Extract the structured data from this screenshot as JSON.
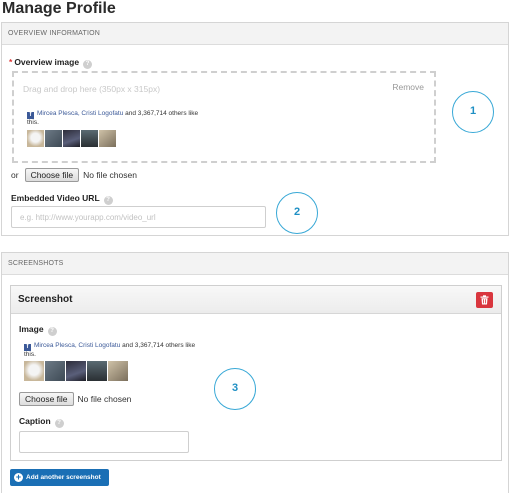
{
  "page": {
    "title": "Manage Profile"
  },
  "overview": {
    "header": "OVERVIEW INFORMATION",
    "image_label": "Overview image",
    "required_mark": "*",
    "dropzone_text": "Drag and drop here (350px x 315px)",
    "remove_label": "Remove",
    "or_label": "or",
    "choose_file_label": "Choose file",
    "no_file_label": "No file chosen",
    "video_label": "Embedded Video URL",
    "video_placeholder": "e.g. http://www.yourapp.com/video_url"
  },
  "facebook_widget": {
    "logo": "f",
    "names": "Mircea Plesca, Cristi Logofatu",
    "rest": " and 3,367,714 others like this."
  },
  "screenshots": {
    "header": "SCREENSHOTS",
    "card_title": "Screenshot",
    "image_label": "Image",
    "choose_file_label": "Choose file",
    "no_file_label": "No file chosen",
    "caption_label": "Caption",
    "caption_value": "",
    "add_button_label": "Add another screenshot"
  },
  "callouts": {
    "one": "1",
    "two": "2",
    "three": "3"
  },
  "colors": {
    "accent": "#1a6fb5",
    "callout": "#38a8d6",
    "danger": "#d9363e",
    "facebook": "#3b5998"
  },
  "icons": {
    "help": "help-icon",
    "trash": "trash-icon",
    "plus": "plus-circle-icon"
  }
}
